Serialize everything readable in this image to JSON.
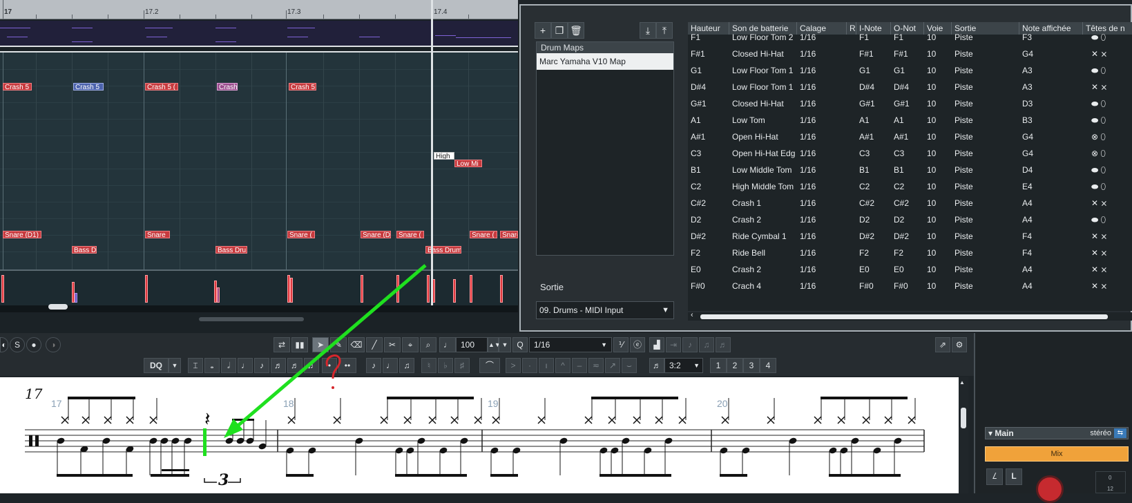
{
  "ruler": {
    "bar": "17",
    "marks": [
      "17.2",
      "17.3",
      "17.4"
    ]
  },
  "notes": {
    "crash": [
      "Crash 5",
      "Crash 5",
      "Crash 5 (",
      "Crash",
      "Crash 5"
    ],
    "high": "High",
    "low_mid": "Low Mi",
    "snare": [
      "Snare (D1)",
      "Snare",
      "Snare (",
      "Snare (D",
      "Snare (",
      "Snare (",
      "Snare"
    ],
    "bass": [
      "Bass D",
      "Bass Dru",
      "Bass Drum"
    ]
  },
  "drum_map_dialog": {
    "toolbar_icons": [
      "plus-icon",
      "duplicate-icon",
      "trash-icon",
      "import-icon",
      "export-icon"
    ],
    "list_header": "Drum Maps",
    "selected_map": "Marc Yamaha V10 Map",
    "output_label": "Sortie",
    "output_value": "09. Drums - MIDI Input",
    "columns": [
      "Hauteur",
      "Son de batterie",
      "Calage",
      "R",
      "I-Note",
      "O-Not",
      "Voie",
      "Sortie",
      "Note affichée",
      "Têtes de n"
    ],
    "rows": [
      {
        "pitch": "F1",
        "sound": "Low Floor Tom 2",
        "quant": "1/16",
        "inote": "F1",
        "onote": "F1",
        "channel": "10",
        "output": "Piste",
        "display": "F3",
        "heads": "oval"
      },
      {
        "pitch": "F#1",
        "sound": "Closed Hi-Hat",
        "quant": "1/16",
        "inote": "F#1",
        "onote": "F#1",
        "channel": "10",
        "output": "Piste",
        "display": "G4",
        "heads": "cross"
      },
      {
        "pitch": "G1",
        "sound": "Low Floor Tom 1",
        "quant": "1/16",
        "inote": "G1",
        "onote": "G1",
        "channel": "10",
        "output": "Piste",
        "display": "A3",
        "heads": "oval"
      },
      {
        "pitch": "D#4",
        "sound": "Low Floor Tom 1",
        "quant": "1/16",
        "inote": "D#4",
        "onote": "D#4",
        "channel": "10",
        "output": "Piste",
        "display": "A3",
        "heads": "cross"
      },
      {
        "pitch": "G#1",
        "sound": "Closed Hi-Hat",
        "quant": "1/16",
        "inote": "G#1",
        "onote": "G#1",
        "channel": "10",
        "output": "Piste",
        "display": "D3",
        "heads": "oval"
      },
      {
        "pitch": "A1",
        "sound": "Low Tom",
        "quant": "1/16",
        "inote": "A1",
        "onote": "A1",
        "channel": "10",
        "output": "Piste",
        "display": "B3",
        "heads": "oval"
      },
      {
        "pitch": "A#1",
        "sound": "Open Hi-Hat",
        "quant": "1/16",
        "inote": "A#1",
        "onote": "A#1",
        "channel": "10",
        "output": "Piste",
        "display": "G4",
        "heads": "circled"
      },
      {
        "pitch": "C3",
        "sound": "Open Hi-Hat Edg",
        "quant": "1/16",
        "inote": "C3",
        "onote": "C3",
        "channel": "10",
        "output": "Piste",
        "display": "G4",
        "heads": "circled"
      },
      {
        "pitch": "B1",
        "sound": "Low Middle Tom",
        "quant": "1/16",
        "inote": "B1",
        "onote": "B1",
        "channel": "10",
        "output": "Piste",
        "display": "D4",
        "heads": "oval"
      },
      {
        "pitch": "C2",
        "sound": "High Middle Tom",
        "quant": "1/16",
        "inote": "C2",
        "onote": "C2",
        "channel": "10",
        "output": "Piste",
        "display": "E4",
        "heads": "oval"
      },
      {
        "pitch": "C#2",
        "sound": "Crash 1",
        "quant": "1/16",
        "inote": "C#2",
        "onote": "C#2",
        "channel": "10",
        "output": "Piste",
        "display": "A4",
        "heads": "cross"
      },
      {
        "pitch": "D2",
        "sound": "Crash 2",
        "quant": "1/16",
        "inote": "D2",
        "onote": "D2",
        "channel": "10",
        "output": "Piste",
        "display": "A4",
        "heads": "oval"
      },
      {
        "pitch": "D#2",
        "sound": "Ride Cymbal 1",
        "quant": "1/16",
        "inote": "D#2",
        "onote": "D#2",
        "channel": "10",
        "output": "Piste",
        "display": "F4",
        "heads": "cross"
      },
      {
        "pitch": "F2",
        "sound": "Ride Bell",
        "quant": "1/16",
        "inote": "F2",
        "onote": "F2",
        "channel": "10",
        "output": "Piste",
        "display": "F4",
        "heads": "cross"
      },
      {
        "pitch": "E0",
        "sound": "Crash 2",
        "quant": "1/16",
        "inote": "E0",
        "onote": "E0",
        "channel": "10",
        "output": "Piste",
        "display": "A4",
        "heads": "cross"
      },
      {
        "pitch": "F#0",
        "sound": "Crach 4",
        "quant": "1/16",
        "inote": "F#0",
        "onote": "F#0",
        "channel": "10",
        "output": "Piste",
        "display": "A4",
        "heads": "cross"
      }
    ]
  },
  "toolbar1": {
    "solo": "S",
    "velocity": "100",
    "quantize_label": "Q",
    "quantize_value": "1/16"
  },
  "toolbar2": {
    "display_quant": "DQ",
    "tuplet_value": "3:2",
    "voices": [
      "1",
      "2",
      "3",
      "4"
    ]
  },
  "score": {
    "bar_numbers": [
      "17",
      "18",
      "19",
      "20"
    ],
    "triplet": "3"
  },
  "mixer": {
    "channel": "Main",
    "format": "stéréo",
    "mix_label": "Mix",
    "buttons": [
      "L"
    ],
    "meter_scale": [
      "0",
      "12"
    ]
  },
  "colors": {
    "note_red": "#c73a3e",
    "annotation_green": "#1fe01f",
    "annotation_red": "#d6262c",
    "mix_orange": "#f0a23a"
  }
}
